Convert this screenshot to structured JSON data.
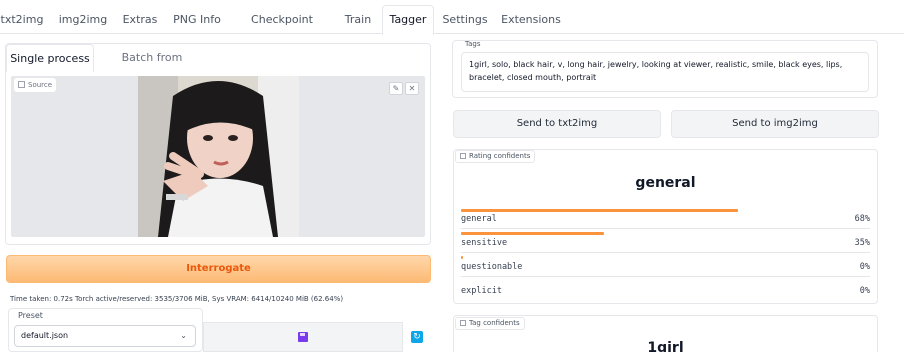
{
  "top_tabs": [
    "txt2img",
    "img2img",
    "Extras",
    "PNG Info",
    "Checkpoint Merger",
    "Train",
    "Tagger",
    "Settings",
    "Extensions"
  ],
  "active_top_tab": "Tagger",
  "sub_tabs": [
    "Single process",
    "Batch from directory"
  ],
  "active_sub_tab": "Single process",
  "image": {
    "label": "Source",
    "edit_icon": "pencil-icon",
    "close_icon": "close-icon"
  },
  "interrogate_label": "Interrogate",
  "time_taken": "Time taken: 0.72s  Torch active/reserved: 3535/3706 MiB, Sys VRAM: 6414/10240 MiB (62.64%)",
  "preset": {
    "label": "Preset",
    "value": "default.json"
  },
  "tags": {
    "label": "Tags",
    "text": "1girl, solo, black hair, v, long hair, jewelry, looking at viewer, realistic, smile, black eyes, lips, bracelet, closed mouth, portrait"
  },
  "send_to_txt2img": "Send to txt2img",
  "send_to_img2img": "Send to img2img",
  "rating": {
    "label": "Rating confidents",
    "top": "general",
    "items": [
      {
        "name": "general",
        "value": "68%",
        "fraction": 0.68
      },
      {
        "name": "sensitive",
        "value": "35%",
        "fraction": 0.35
      },
      {
        "name": "questionable",
        "value": "0%",
        "fraction": 0.0
      },
      {
        "name": "explicit",
        "value": "0%",
        "fraction": 0.0
      }
    ]
  },
  "tag_conf": {
    "label": "Tag confidents",
    "top": "1girl"
  },
  "colors": {
    "accent_orange": "#fb923c",
    "interrogate_text": "#ea580c",
    "refresh_blue": "#0ea5e9",
    "save_purple": "#7c3aed"
  }
}
